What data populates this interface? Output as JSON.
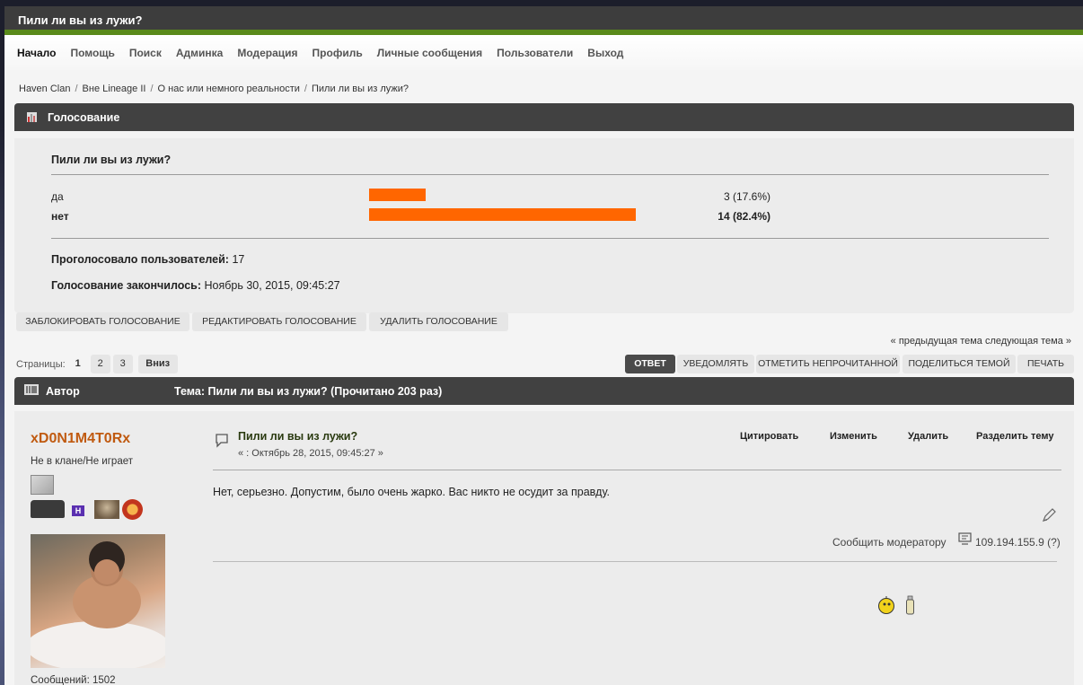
{
  "window_title": "Пили ли вы из лужи?",
  "menu": [
    "Начало",
    "Помощь",
    "Поиск",
    "Админка",
    "Модерация",
    "Профиль",
    "Личные сообщения",
    "Пользователи",
    "Выход"
  ],
  "breadcrumb": [
    "Haven Clan",
    "Вне Lineage II",
    "О нас или немного реальности",
    "Пили ли вы из лужи?"
  ],
  "poll": {
    "header": "Голосование",
    "question": "Пили ли вы из лужи?",
    "options": [
      {
        "label": "да",
        "value_text": "3 (17.6%)",
        "percent": 17.6,
        "bold": false
      },
      {
        "label": "нет",
        "value_text": "14 (82.4%)",
        "percent": 82.4,
        "bold": true
      }
    ],
    "voters_label": "Проголосовало пользователей:",
    "voters_value": "17",
    "ended_label": "Голосование закончилось:",
    "ended_value": "Ноябрь 30, 2015, 09:45:27",
    "buttons": [
      "Заблокировать голосование",
      "Редактировать голосование",
      "Удалить голосование"
    ],
    "bar_color": "#ff6600"
  },
  "topic_nav": "« предыдущая тема следующая тема »",
  "pages": {
    "label": "Страницы:",
    "items": [
      "1",
      "2",
      "3"
    ],
    "go": "Вниз"
  },
  "topic_buttons": [
    "Ответ",
    "Уведомлять",
    "Отметить непрочитанной",
    "Поделиться темой",
    "Печать"
  ],
  "topic_bar": {
    "author_label": "Автор",
    "title": "Тема: Пили ли вы из лужи?  (Прочитано 203 раз)"
  },
  "post": {
    "author": "xD0N1M4T0Rx",
    "status": "Не в клане/Не играет",
    "messages": "Сообщений: 1502",
    "title": "Пили ли вы из лужи?",
    "date": "« : Октябрь 28, 2015, 09:45:27 »",
    "actions": [
      "Цитировать",
      "Изменить",
      "Удалить",
      "Разделить тему"
    ],
    "body": "Нет, серьезно. Допустим, было очень жарко. Вас никто не осудит за правду.",
    "report": "Сообщить модератору",
    "ip": "109.194.155.9 (?)"
  }
}
